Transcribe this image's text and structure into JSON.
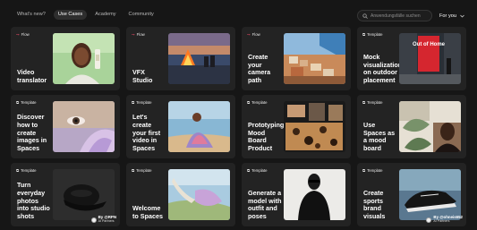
{
  "nav": {
    "tabs": [
      {
        "label": "What's new?"
      },
      {
        "label": "Use Cases"
      },
      {
        "label": "Academy"
      },
      {
        "label": "Community"
      }
    ],
    "search_placeholder": "Anwendungsfälle suchen",
    "filter_label": "For you"
  },
  "cards": [
    {
      "badge": "Flow",
      "title": "Video translator"
    },
    {
      "badge": "Flow",
      "title": "VFX Studio"
    },
    {
      "badge": "Flow",
      "title": "Create your camera path"
    },
    {
      "badge": "Template",
      "title": "Mock visualization on outdoor placement",
      "billboard_text": "Out of Home"
    },
    {
      "badge": "Template",
      "title": "Discover how to create images in Spaces"
    },
    {
      "badge": "Template",
      "title": "Let's create your first video in Spaces"
    },
    {
      "badge": "Template",
      "title": "Prototyping Mood Board Product"
    },
    {
      "badge": "Template",
      "title": "Use Spaces as a mood board"
    },
    {
      "badge": "Template",
      "title": "Turn everyday photos into studio shots",
      "credit_name": "By @RPN",
      "credit_role": "AI Partners"
    },
    {
      "badge": "Template",
      "title": "Welcome to Spaces"
    },
    {
      "badge": "Template",
      "title": "Generate a model with outfit and poses"
    },
    {
      "badge": "Template",
      "title": "Create sports brand visuals",
      "credit_name": "By @ohneis652",
      "credit_role": "AI Partners"
    }
  ],
  "colors": {
    "background": "#161616",
    "card": "#232323",
    "flow_accent": "#ff4f6e",
    "active_tab": "#2e2e2e"
  },
  "icons": {
    "search": "search-icon",
    "filter_chevron": "chevron-down-icon",
    "flow_badge": "flow-icon",
    "template_badge": "template-icon"
  }
}
